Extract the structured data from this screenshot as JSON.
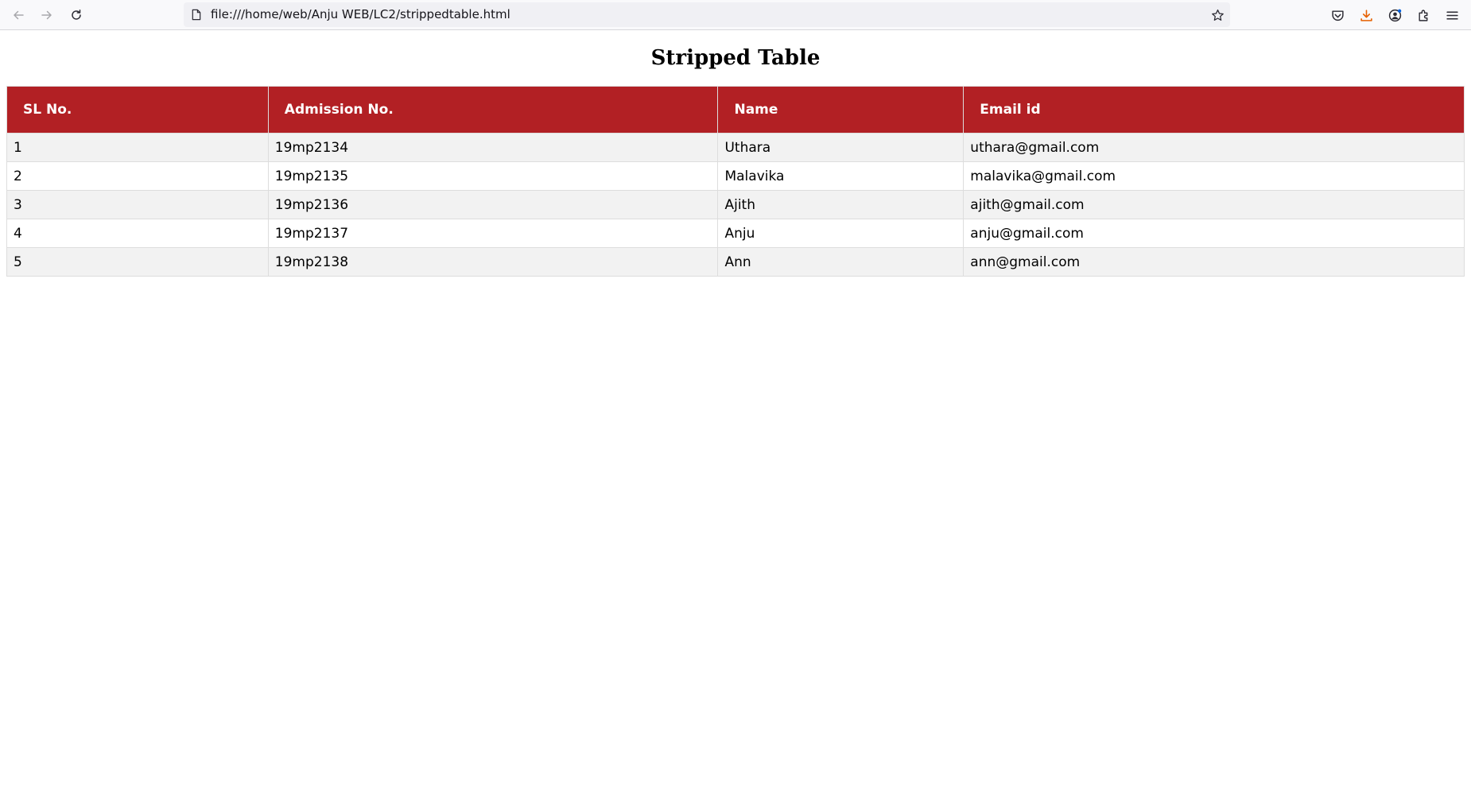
{
  "browser": {
    "url": "file:///home/web/Anju WEB/LC2/strippedtable.html",
    "icons": {
      "back": "arrow-left-icon",
      "forward": "arrow-right-icon",
      "reload": "reload-icon",
      "page": "page-icon",
      "bookmark": "star-icon",
      "pocket": "pocket-icon",
      "downloads": "download-icon",
      "account": "account-icon",
      "extensions": "puzzle-icon",
      "menu": "hamburger-menu-icon"
    },
    "colors": {
      "download_accent": "#e66000",
      "notification_dot": "#0060df"
    }
  },
  "page": {
    "title": "Stripped Table"
  },
  "table": {
    "header_color": "#b22024",
    "stripe_color": "#f2f2f2",
    "headers": [
      "SL No.",
      "Admission No.",
      "Name",
      "Email id"
    ],
    "rows": [
      [
        "1",
        "19mp2134",
        "Uthara",
        "uthara@gmail.com"
      ],
      [
        "2",
        "19mp2135",
        "Malavika",
        "malavika@gmail.com"
      ],
      [
        "3",
        "19mp2136",
        "Ajith",
        "ajith@gmail.com"
      ],
      [
        "4",
        "19mp2137",
        "Anju",
        "anju@gmail.com"
      ],
      [
        "5",
        "19mp2138",
        "Ann",
        "ann@gmail.com"
      ]
    ]
  }
}
